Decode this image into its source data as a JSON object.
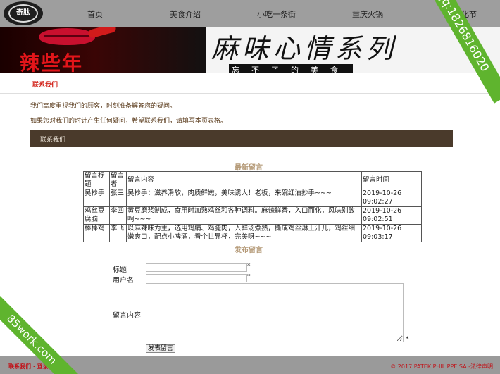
{
  "logo": {
    "text": "奇肽"
  },
  "nav": {
    "items": [
      "首页",
      "美食介绍",
      "小吃一条街",
      "重庆火锅",
      "化节"
    ]
  },
  "banner": {
    "brand": "辣些年",
    "slogan": "麻味心情系列",
    "subtitle": "忘不了的美食"
  },
  "breadcrumb": "联系我们",
  "intro": [
    "我们高度重视我们的顾客，时刻准备解答您的疑问。",
    "如果您对我们的时计产生任何疑问，希望联系我们，请填写本页表格。"
  ],
  "section": {
    "title": "联系我们"
  },
  "messages": {
    "title": "最新留言",
    "headers": [
      "留言标题",
      "留言者",
      "留言内容",
      "留言时间"
    ],
    "rows": [
      {
        "title": "吴抄手",
        "author": "张三",
        "content": "吴抄手：滋养滑软，肉质鲜嫩，美味诱人！老板，来碗红油抄手~~~",
        "time": "2019-10-26 09:02:27"
      },
      {
        "title": "鸡丝豆腐脑",
        "author": "李四",
        "content": "黄豆磨浆制成，食用时加熟鸡丝和各种调料。麻辣鲜香，入口而化，风味别致啊~~~",
        "time": "2019-10-26 09:02:51"
      },
      {
        "title": "棒棒鸡",
        "author": "李飞",
        "content": "以麻辣味为主，选用鸡脯、鸡腿肉，入鲜汤煮熟，撕成鸡丝淋上汁儿，鸡丝细嫩爽口，配点小啤酒，看个世界杯，完美呀~~~",
        "time": "2019-10-26 09:03:17"
      }
    ]
  },
  "form": {
    "title": "发布留言",
    "title_label": "标题",
    "title_value": "",
    "username_label": "用户名",
    "username_value": "",
    "content_label": "留言内容",
    "content_value": "",
    "required_mark": "*",
    "submit_label": "发表留言"
  },
  "footer": {
    "left": "联系我们",
    "left_extra": "登录",
    "right": "© 2017 PATEK PHILIPPE SA -法律声明"
  },
  "watermarks": {
    "top": "qq:1826816020",
    "bottom": "85work.com"
  },
  "colors": {
    "nav_bg": "#9e9e9e",
    "accent_red": "#d2231a",
    "section_bar": "#4a3a2b",
    "sub_title": "#b59a78",
    "watermark": "#5fb42e"
  }
}
